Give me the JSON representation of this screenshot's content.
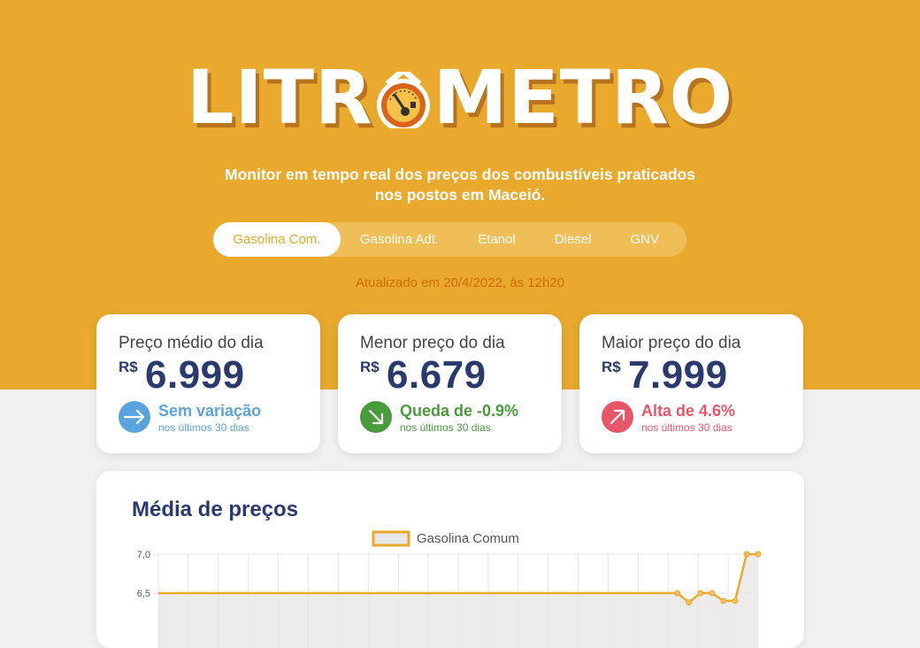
{
  "header": {
    "logo_left": "LITR",
    "logo_right": "METRO",
    "subtitle_line1": "Monitor em tempo real dos preços dos combustíveis praticados",
    "subtitle_line2": "nos postos em Maceió.",
    "updated": "Atualizado em 20/4/2022, às 12h20"
  },
  "tabs": [
    {
      "label": "Gasolina Com.",
      "active": true
    },
    {
      "label": "Gasolina Adt.",
      "active": false
    },
    {
      "label": "Etanol",
      "active": false
    },
    {
      "label": "Diesel",
      "active": false
    },
    {
      "label": "GNV",
      "active": false
    }
  ],
  "cards": [
    {
      "title": "Preço médio do dia",
      "currency": "R$",
      "value": "6.999",
      "trend_label": "Sem variação",
      "trend_sub": "nos últimos 30 dias",
      "trend_icon": "arrow-right-icon",
      "color": "#5ba3dc"
    },
    {
      "title": "Menor preço do dia",
      "currency": "R$",
      "value": "6.679",
      "trend_label": "Queda de -0.9%",
      "trend_sub": "nos últimos 30 dias",
      "trend_icon": "arrow-down-right-icon",
      "color": "#4a9a3e"
    },
    {
      "title": "Maior preço do dia",
      "currency": "R$",
      "value": "7.999",
      "trend_label": "Alta de 4.6%",
      "trend_sub": "nos últimos 30 dias",
      "trend_icon": "arrow-up-right-icon",
      "color": "#e8566a"
    }
  ],
  "chart_panel": {
    "title": "Média de preços"
  },
  "chart_data": {
    "type": "line",
    "legend": "Gasolina Comum",
    "yticks": [
      "7,0",
      "6,5"
    ],
    "ylim_visible": [
      6.5,
      7.0
    ],
    "series": [
      {
        "name": "Gasolina Comum",
        "values": [
          6.5,
          6.5,
          6.5,
          6.5,
          6.5,
          6.5,
          6.5,
          6.5,
          6.5,
          6.5,
          6.5,
          6.5,
          6.5,
          6.5,
          6.5,
          6.5,
          6.5,
          6.5,
          6.5,
          6.5,
          6.5,
          6.5,
          6.5,
          6.5,
          6.5,
          6.5,
          6.5,
          6.5,
          6.5,
          6.5,
          6.5,
          6.5,
          6.5,
          6.5,
          6.5,
          6.5,
          6.5,
          6.5,
          6.5,
          6.5,
          6.5,
          6.5,
          6.5,
          6.5,
          6.5,
          6.5,
          6.38,
          6.5,
          6.5,
          6.4,
          6.4,
          7.0,
          7.0
        ]
      }
    ],
    "colors": {
      "line": "#e8a92c",
      "fill": "#e7e7e7"
    }
  }
}
